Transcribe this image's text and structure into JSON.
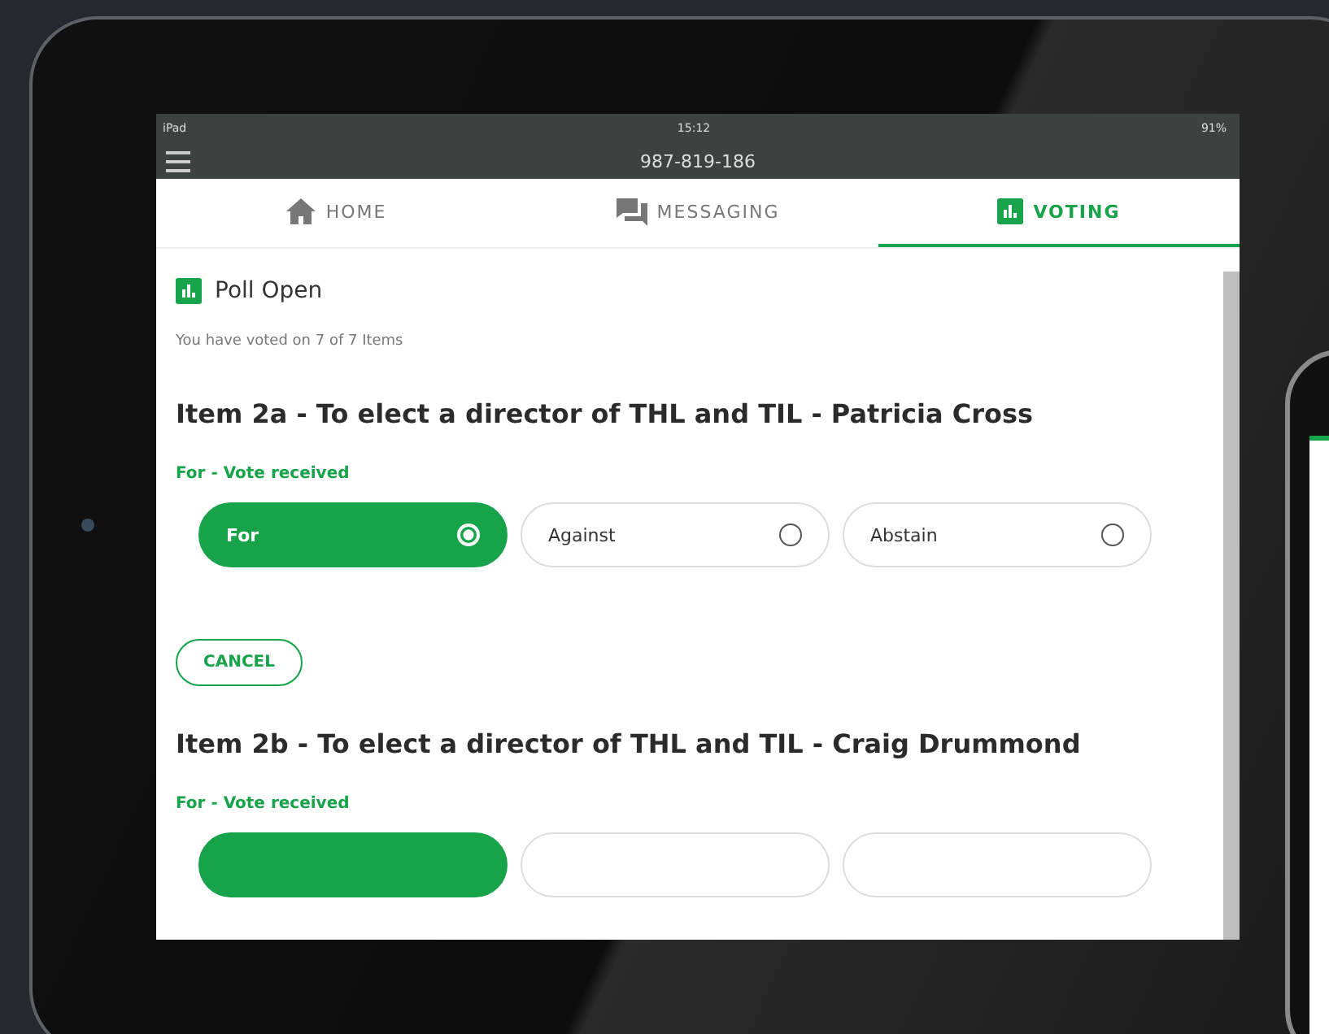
{
  "status_bar": {
    "device": "iPad",
    "time": "15:12",
    "battery": "91%"
  },
  "header": {
    "title": "987-819-186"
  },
  "tabs": [
    {
      "label": "HOME",
      "kind": "home",
      "selected": false
    },
    {
      "label": "MESSAGING",
      "kind": "chat",
      "selected": false
    },
    {
      "label": "VOTING",
      "kind": "chart",
      "selected": true
    }
  ],
  "poll": {
    "title": "Poll Open",
    "summary": "You have voted on 7 of 7 Items"
  },
  "items": [
    {
      "title": "Item 2a - To elect a director of THL and TIL - Patricia Cross",
      "status": "For - Vote received",
      "options": [
        {
          "label": "For",
          "selected": true
        },
        {
          "label": "Against",
          "selected": false
        },
        {
          "label": "Abstain",
          "selected": false
        }
      ],
      "cancel": "CANCEL"
    },
    {
      "title": "Item 2b - To elect a director of THL and TIL - Craig Drummond",
      "status": "For - Vote received",
      "options": [
        {
          "selected": true
        },
        {
          "selected": false
        },
        {
          "selected": false
        }
      ]
    }
  ]
}
